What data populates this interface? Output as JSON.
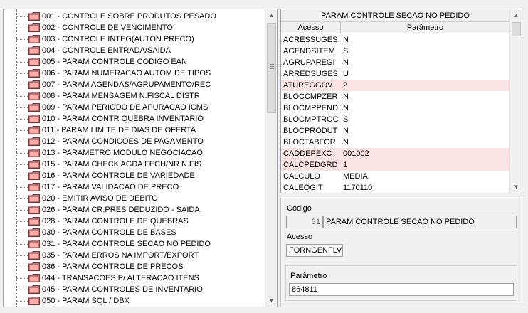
{
  "tree": {
    "items": [
      {
        "label": "001 - CONTROLE SOBRE PRODUTOS PESADO"
      },
      {
        "label": "002 - CONTROLE DE VENCIMENTO"
      },
      {
        "label": "003 - CONTROLE INTEG(AUTON.PRECO)"
      },
      {
        "label": "004 - CONTROLE ENTRADA/SAIDA"
      },
      {
        "label": "005 - PARAM CONTROLE CODIGO EAN"
      },
      {
        "label": "006 - PARAM NUMERACAO AUTOM DE TIPOS"
      },
      {
        "label": "007 - PARAM AGENDAS/AGRUPAMENTO/REC"
      },
      {
        "label": "008 - PARAM MENSAGEM N.FISCAL DISTR"
      },
      {
        "label": "009 - PARAM PERIODO DE APURACAO ICMS"
      },
      {
        "label": "010 - PARAM CONTR QUEBRA INVENTARIO"
      },
      {
        "label": "011 - PARAM LIMITE DE DIAS DE OFERTA"
      },
      {
        "label": "012 - PARAM CONDICOES DE PAGAMENTO"
      },
      {
        "label": "013 - PARAMETRO MODULO NEGOCIACAO"
      },
      {
        "label": "015 - PARAM CHECK AGDA FECH/NR.N.FIS"
      },
      {
        "label": "016 - PARAM CONTROLE DE VARIEDADE"
      },
      {
        "label": "017 - PARAM VALIDACAO DE PRECO"
      },
      {
        "label": "020 - EMITIR AVISO DE DEBITO"
      },
      {
        "label": "026 - PARAM CR.PRES DEDUZIDO - SAIDA"
      },
      {
        "label": "028 - PARAM CONTROLE DE QUEBRAS"
      },
      {
        "label": "030 - PARAM CONTROLE DE BASES"
      },
      {
        "label": "031 - PARAM CONTROLE SECAO NO PEDIDO"
      },
      {
        "label": "035 - PARAM ERROS NA IMPORT/EXPORT"
      },
      {
        "label": "036 - PARAM CONTROLE DE PRECOS"
      },
      {
        "label": "044 - TRANSACOES P/ ALTERACAO ITENS"
      },
      {
        "label": "045 - PARAM CONTROLES DE INVENTARIO"
      },
      {
        "label": "050 - PARAM SQL / DBX"
      }
    ]
  },
  "grid": {
    "title": "PARAM CONTROLE SECAO NO PEDIDO",
    "columns": {
      "acesso": "Acesso",
      "parametro": "Parâmetro"
    },
    "rows": [
      {
        "acesso": "ACRESSUGES",
        "parametro": "N",
        "highlight": false
      },
      {
        "acesso": "AGENDSITEM",
        "parametro": "S",
        "highlight": false
      },
      {
        "acesso": "AGRUPAREGI",
        "parametro": "N",
        "highlight": false
      },
      {
        "acesso": "ARREDSUGES",
        "parametro": "U",
        "highlight": false
      },
      {
        "acesso": "ATUREGGOV",
        "parametro": "2",
        "highlight": true
      },
      {
        "acesso": "BLOCCMPZER",
        "parametro": "N",
        "highlight": false
      },
      {
        "acesso": "BLOCMPPEND",
        "parametro": "N",
        "highlight": false
      },
      {
        "acesso": "BLOCMPTROC",
        "parametro": "S",
        "highlight": false
      },
      {
        "acesso": "BLOCPRODUT",
        "parametro": "N",
        "highlight": false
      },
      {
        "acesso": "BLOCTABFOR",
        "parametro": "N",
        "highlight": false
      },
      {
        "acesso": "CADDEPEXC",
        "parametro": "001002",
        "highlight": true
      },
      {
        "acesso": "CALCPEDGRD",
        "parametro": "1",
        "highlight": true
      },
      {
        "acesso": "CALCULO",
        "parametro": "MEDIA",
        "highlight": false
      },
      {
        "acesso": "CALEQGIT",
        "parametro": "1170110",
        "highlight": false
      }
    ]
  },
  "detail": {
    "codigo_label": "Código",
    "codigo_value": "31",
    "codigo_desc": "PARAM CONTROLE SECAO NO PEDIDO",
    "acesso_label": "Acesso",
    "acesso_value": "FORNGENFLV",
    "parametro_label": "Parâmetro",
    "parametro_value": "864811"
  },
  "colors": {
    "highlight_row": "#fbe3e3",
    "folder": "#d86a6a"
  }
}
